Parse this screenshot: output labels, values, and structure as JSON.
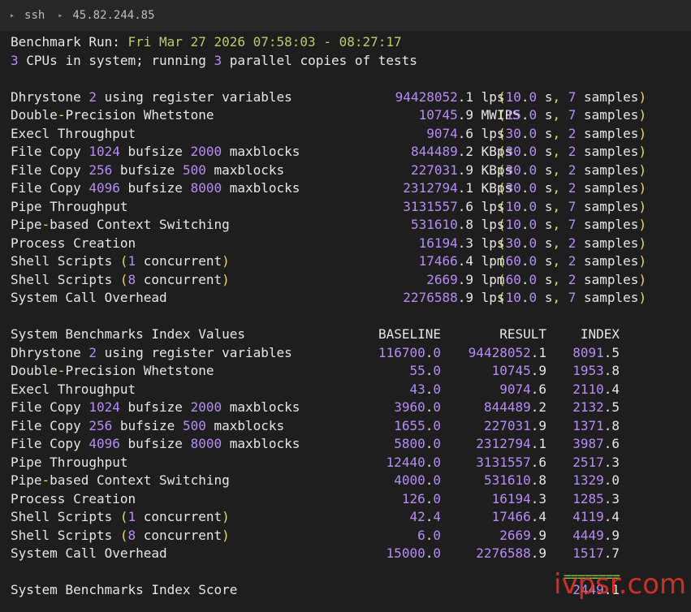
{
  "titlebar": {
    "segments": [
      "ssh",
      "45.82.244.85"
    ]
  },
  "run": {
    "label": "Benchmark Run:",
    "time": "Fri Mar 27 2026 07:58:03 - 08:27:17",
    "cpu_line": [
      "3",
      " CPUs in system; running ",
      "3",
      " parallel copies of tests"
    ]
  },
  "results": [
    {
      "name": "Dhrystone 2 using register variables",
      "value": "94428052.1",
      "unit": "lps",
      "time": "10.0",
      "samples": "7"
    },
    {
      "name": "Double-Precision Whetstone",
      "value": "10745.9",
      "unit": "MWIPS",
      "time": "15.0",
      "samples": "7"
    },
    {
      "name": "Execl Throughput",
      "value": "9074.6",
      "unit": "lps",
      "time": "30.0",
      "samples": "2"
    },
    {
      "name": "File Copy 1024 bufsize 2000 maxblocks",
      "value": "844489.2",
      "unit": "KBps",
      "time": "30.0",
      "samples": "2"
    },
    {
      "name": "File Copy 256 bufsize 500 maxblocks",
      "value": "227031.9",
      "unit": "KBps",
      "time": "30.0",
      "samples": "2"
    },
    {
      "name": "File Copy 4096 bufsize 8000 maxblocks",
      "value": "2312794.1",
      "unit": "KBps",
      "time": "30.0",
      "samples": "2"
    },
    {
      "name": "Pipe Throughput",
      "value": "3131557.6",
      "unit": "lps",
      "time": "10.0",
      "samples": "7"
    },
    {
      "name": "Pipe-based Context Switching",
      "value": "531610.8",
      "unit": "lps",
      "time": "10.0",
      "samples": "7"
    },
    {
      "name": "Process Creation",
      "value": "16194.3",
      "unit": "lps",
      "time": "30.0",
      "samples": "2"
    },
    {
      "name": "Shell Scripts (1 concurrent)",
      "value": "17466.4",
      "unit": "lpm",
      "time": "60.0",
      "samples": "2"
    },
    {
      "name": "Shell Scripts (8 concurrent)",
      "value": "2669.9",
      "unit": "lpm",
      "time": "60.0",
      "samples": "2"
    },
    {
      "name": "System Call Overhead",
      "value": "2276588.9",
      "unit": "lps",
      "time": "10.0",
      "samples": "7"
    }
  ],
  "index": {
    "title": "System Benchmarks Index Values",
    "headers": [
      "BASELINE",
      "RESULT",
      "INDEX"
    ],
    "rows": [
      {
        "name": "Dhrystone 2 using register variables",
        "baseline": "116700.0",
        "result": "94428052.1",
        "index": "8091.5"
      },
      {
        "name": "Double-Precision Whetstone",
        "baseline": "55.0",
        "result": "10745.9",
        "index": "1953.8"
      },
      {
        "name": "Execl Throughput",
        "baseline": "43.0",
        "result": "9074.6",
        "index": "2110.4"
      },
      {
        "name": "File Copy 1024 bufsize 2000 maxblocks",
        "baseline": "3960.0",
        "result": "844489.2",
        "index": "2132.5"
      },
      {
        "name": "File Copy 256 bufsize 500 maxblocks",
        "baseline": "1655.0",
        "result": "227031.9",
        "index": "1371.8"
      },
      {
        "name": "File Copy 4096 bufsize 8000 maxblocks",
        "baseline": "5800.0",
        "result": "2312794.1",
        "index": "3987.6"
      },
      {
        "name": "Pipe Throughput",
        "baseline": "12440.0",
        "result": "3131557.6",
        "index": "2517.3"
      },
      {
        "name": "Pipe-based Context Switching",
        "baseline": "4000.0",
        "result": "531610.8",
        "index": "1329.0"
      },
      {
        "name": "Process Creation",
        "baseline": "126.0",
        "result": "16194.3",
        "index": "1285.3"
      },
      {
        "name": "Shell Scripts (1 concurrent)",
        "baseline": "42.4",
        "result": "17466.4",
        "index": "4119.4"
      },
      {
        "name": "Shell Scripts (8 concurrent)",
        "baseline": "6.0",
        "result": "2669.9",
        "index": "4449.9"
      },
      {
        "name": "System Call Overhead",
        "baseline": "15000.0",
        "result": "2276588.9",
        "index": "1517.7"
      }
    ],
    "separator": "========",
    "score_label": "System Benchmarks Index Score",
    "score": "2449.1"
  },
  "watermark": "ivpsr.com",
  "colors": {
    "background": "#1e1e1e",
    "number": "#b68df5",
    "punct": "#e9d86e",
    "accent": "#b5cf6b",
    "watermark": "#e5352b"
  }
}
